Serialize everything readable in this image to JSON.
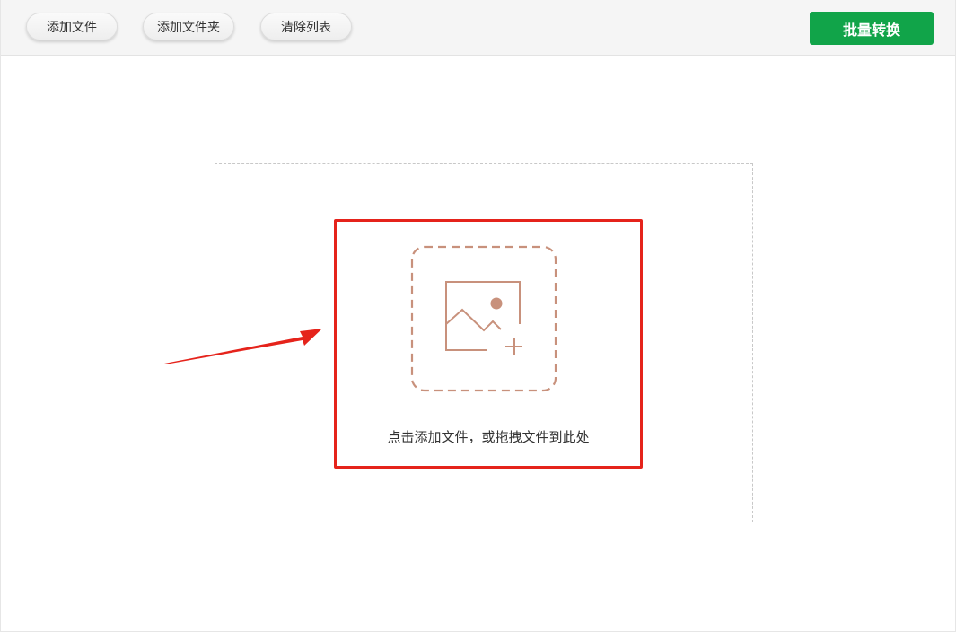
{
  "toolbar": {
    "add_file_label": "添加文件",
    "add_folder_label": "添加文件夹",
    "clear_list_label": "清除列表",
    "batch_convert_label": "批量转换"
  },
  "drop_zone": {
    "hint": "点击添加文件，或拖拽文件到此处",
    "icon": "image-add-icon"
  },
  "colors": {
    "accent_green": "#11a449",
    "highlight_red": "#e5231b",
    "icon_brown": "#c8917c"
  }
}
